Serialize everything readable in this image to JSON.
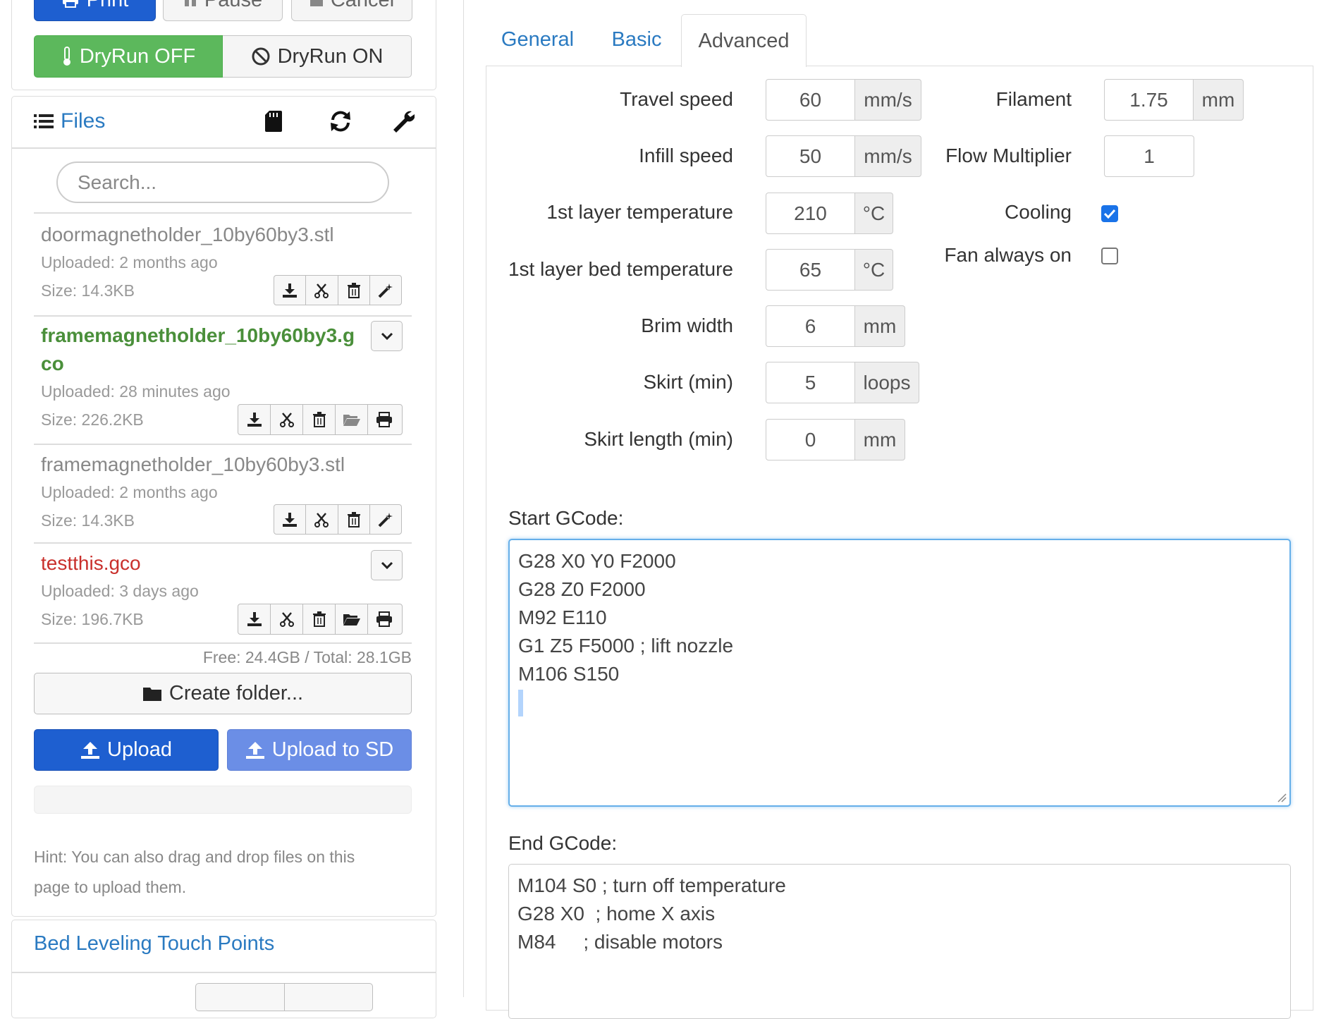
{
  "controls": {
    "print_label": "Print",
    "pause_label": "Pause",
    "cancel_label": "Cancel",
    "dryrun_off_label": "DryRun OFF",
    "dryrun_on_label": "DryRun ON"
  },
  "files": {
    "header_label": "Files",
    "search_placeholder": "Search...",
    "items": [
      {
        "name": "doormagnetholder_10by60by3.stl",
        "uploaded": "Uploaded: 2 months ago",
        "size": "Size: 14.3KB"
      },
      {
        "name": "framemagnetholder_10by60by3.gco",
        "uploaded": "Uploaded: 28 minutes ago",
        "size": "Size: 226.2KB"
      },
      {
        "name": "framemagnetholder_10by60by3.stl",
        "uploaded": "Uploaded: 2 months ago",
        "size": "Size: 14.3KB"
      },
      {
        "name": "testthis.gco",
        "uploaded": "Uploaded: 3 days ago",
        "size": "Size: 196.7KB"
      }
    ],
    "storage": "Free: 24.4GB / Total: 28.1GB",
    "create_folder_label": "Create folder...",
    "upload_label": "Upload",
    "upload_sd_label": "Upload to SD",
    "progress": 0,
    "hint": "Hint: You can also drag and drop files on this page to upload them."
  },
  "bed_leveling": {
    "title": "Bed Leveling Touch Points"
  },
  "tabs": [
    {
      "label": "General"
    },
    {
      "label": "Basic"
    },
    {
      "label": "Advanced"
    }
  ],
  "active_tab": "Advanced",
  "settings": {
    "travel_speed": {
      "label": "Travel speed",
      "value": "60",
      "unit": "mm/s"
    },
    "infill_speed": {
      "label": "Infill speed",
      "value": "50",
      "unit": "mm/s"
    },
    "first_layer_temp": {
      "label": "1st layer temperature",
      "value": "210",
      "unit": "°C"
    },
    "first_layer_bed_temp": {
      "label": "1st layer bed temperature",
      "value": "65",
      "unit": "°C"
    },
    "brim_width": {
      "label": "Brim width",
      "value": "6",
      "unit": "mm"
    },
    "skirt_min": {
      "label": "Skirt (min)",
      "value": "5",
      "unit": "loops"
    },
    "skirt_length_min": {
      "label": "Skirt length (min)",
      "value": "0",
      "unit": "mm"
    },
    "filament": {
      "label": "Filament",
      "value": "1.75",
      "unit": "mm"
    },
    "flow_multiplier": {
      "label": "Flow Multiplier",
      "value": "1"
    },
    "cooling": {
      "label": "Cooling",
      "checked": true
    },
    "fan_always_on": {
      "label": "Fan always on",
      "checked": false
    }
  },
  "start_gcode": {
    "label": "Start GCode:",
    "lines": [
      "G28 X0 Y0 F2000",
      "G28 Z0 F2000",
      "M92 E110",
      "G1 Z5 F5000 ; lift nozzle",
      "M106 S150"
    ]
  },
  "end_gcode": {
    "label": "End GCode:",
    "lines": [
      "M104 S0 ; turn off temperature",
      "G28 X0  ; home X axis",
      "M84     ; disable motors"
    ]
  },
  "colors": {
    "primary": "#1e5fd0",
    "success": "#5cb85c",
    "link": "#2a7ac1",
    "gcode_file": "#4a8f3a",
    "error_file": "#c9302c"
  }
}
